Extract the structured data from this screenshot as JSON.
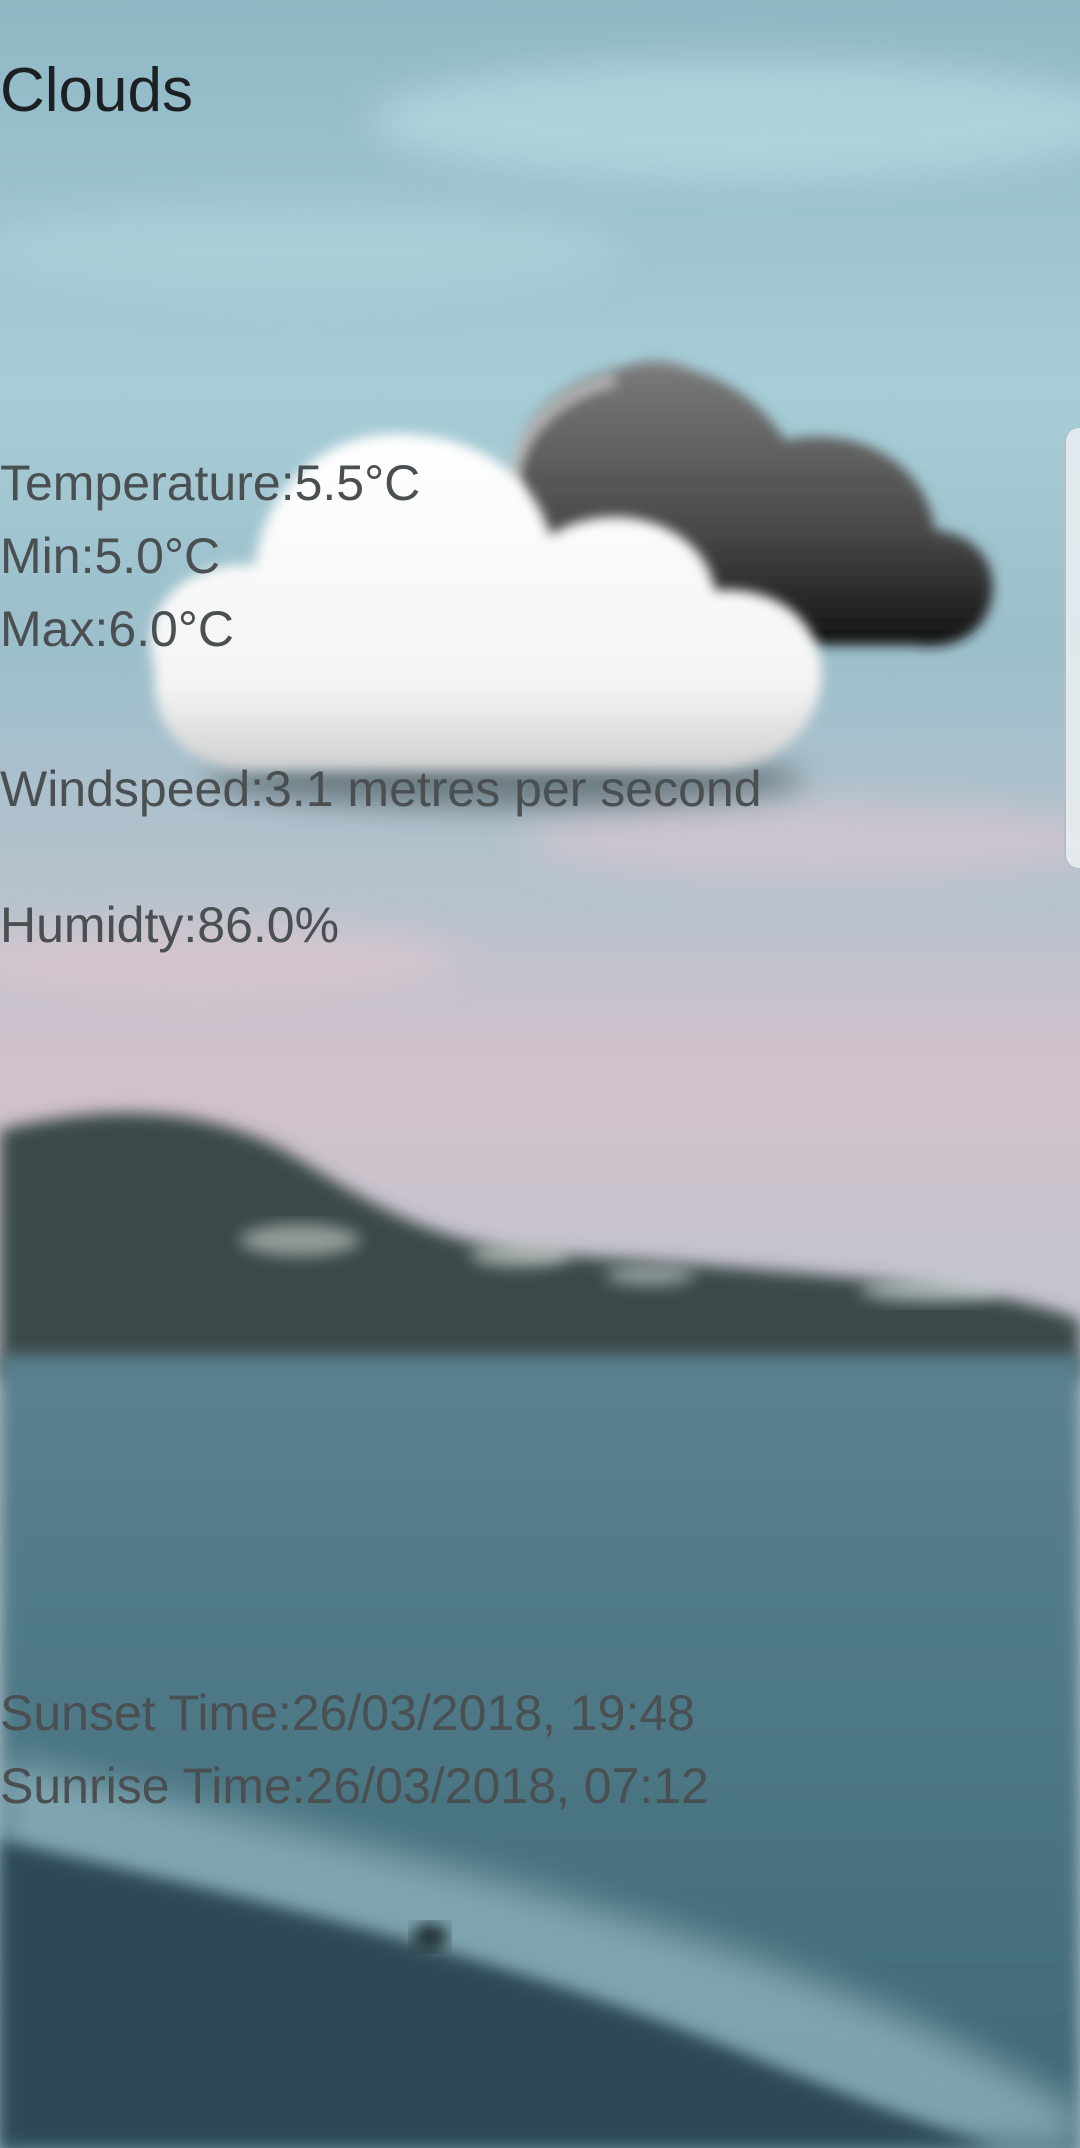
{
  "weather": {
    "condition": "Clouds",
    "icon": "clouds-icon",
    "temperature": "Temperature:5.5°C",
    "min": "Min:5.0°C",
    "max": "Max:6.0°C",
    "windspeed": "Windspeed:3.1 metres per second",
    "humidity": "Humidty:86.0%",
    "sunset": "Sunset Time:26/03/2018, 19:48",
    "sunrise": "Sunrise Time:26/03/2018, 07:12"
  },
  "background": {
    "sky_top": "#8fb9c6",
    "sky_pink": "#d9c3cd",
    "hill": "#3c4a4b",
    "sea": "#4d7683",
    "sand": "#2e4b57"
  }
}
